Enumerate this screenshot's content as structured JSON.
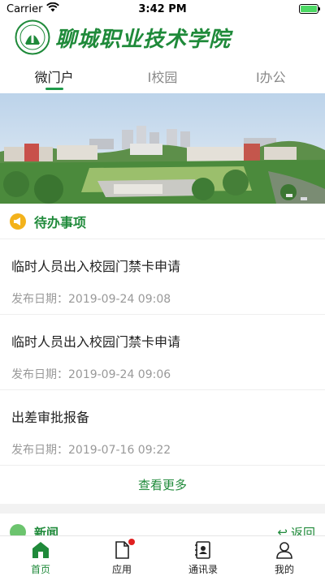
{
  "status_bar": {
    "carrier": "Carrier",
    "time": "3:42 PM",
    "battery_level": 1.0
  },
  "header": {
    "school_name": "聊城职业技术学院",
    "logo_icon": "school-seal-icon"
  },
  "tabs": [
    {
      "label": "微门户",
      "active": true
    },
    {
      "label": "I校园",
      "active": false
    },
    {
      "label": "I办公",
      "active": false
    }
  ],
  "todo": {
    "title": "待办事项",
    "icon": "megaphone-icon",
    "items": [
      {
        "title": "临时人员出入校园门禁卡申请",
        "date_label": "发布日期：",
        "date": "2019-09-24 09:08"
      },
      {
        "title": "临时人员出入校园门禁卡申请",
        "date_label": "发布日期：",
        "date": "2019-09-24 09:06"
      },
      {
        "title": "出差审批报备",
        "date_label": "发布日期：",
        "date": "2019-07-16 09:22"
      }
    ],
    "more_label": "查看更多"
  },
  "news": {
    "title": "新闻",
    "back_label": "返回"
  },
  "tabbar": [
    {
      "label": "首页",
      "icon": "home-icon",
      "active": true,
      "badge": false
    },
    {
      "label": "应用",
      "icon": "apps-document-icon",
      "active": false,
      "badge": true
    },
    {
      "label": "通讯录",
      "icon": "contacts-book-icon",
      "active": false,
      "badge": false
    },
    {
      "label": "我的",
      "icon": "user-profile-icon",
      "active": false,
      "badge": false
    }
  ],
  "colors": {
    "brand_green": "#1f8a3a",
    "todo_icon": "#f3b21b",
    "badge": "#e02020"
  }
}
